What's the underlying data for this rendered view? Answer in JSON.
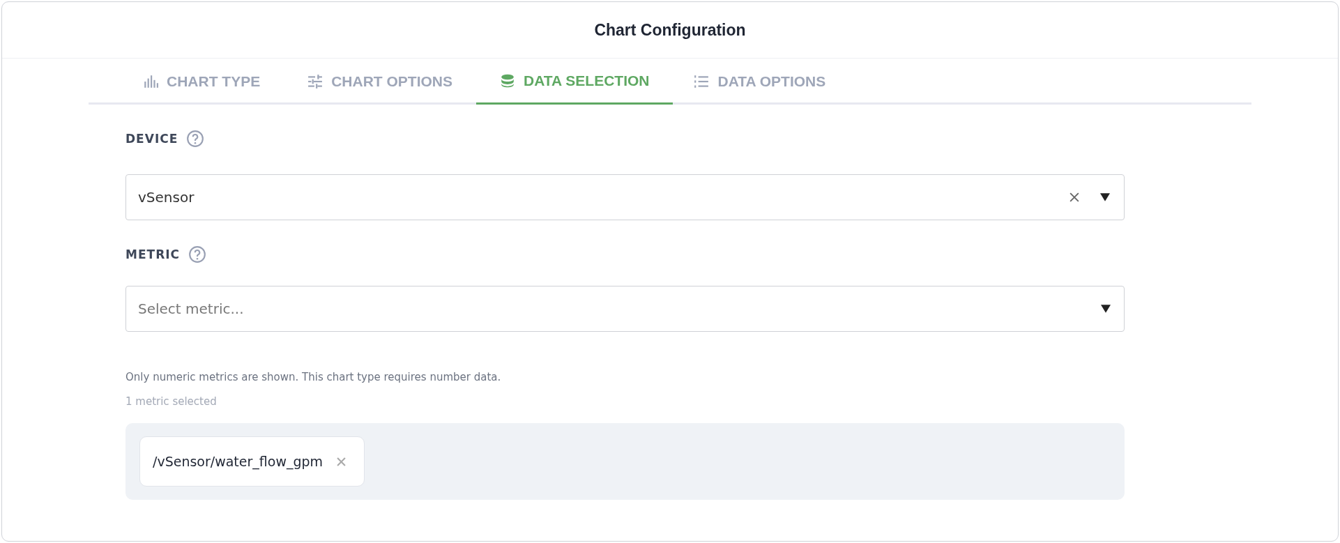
{
  "window": {
    "title": "Chart Configuration"
  },
  "tabs": [
    {
      "label": "CHART TYPE",
      "kind": "bars",
      "selected": false
    },
    {
      "label": "CHART OPTIONS",
      "kind": "sliders",
      "selected": false
    },
    {
      "label": "DATA SELECTION",
      "kind": "database",
      "selected": true
    },
    {
      "label": "DATA OPTIONS",
      "kind": "list",
      "selected": false
    }
  ],
  "device": {
    "label": "DEVICE",
    "value": "vSensor"
  },
  "metric": {
    "label": "METRIC",
    "placeholder": "Select metric..."
  },
  "hint": "Only numeric metrics are shown. This chart type requires number data.",
  "selected_count": "1 metric selected",
  "chips": [
    {
      "label": "/vSensor/water_flow_gpm"
    }
  ]
}
